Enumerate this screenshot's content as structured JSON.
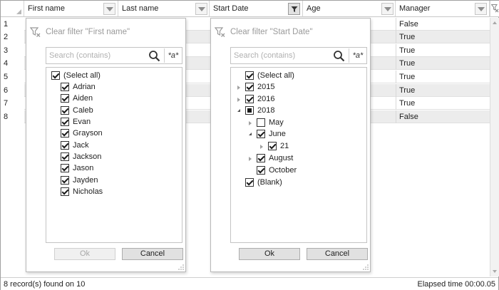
{
  "columns": [
    {
      "label": "First name",
      "filter_active": false
    },
    {
      "label": "Last name",
      "filter_active": false
    },
    {
      "label": "Start Date",
      "filter_active": true
    },
    {
      "label": "Age",
      "filter_active": false
    },
    {
      "label": "Manager",
      "filter_active": false
    }
  ],
  "rows": [
    {
      "num": "1",
      "manager": "False"
    },
    {
      "num": "2",
      "manager": "True"
    },
    {
      "num": "3",
      "manager": "True"
    },
    {
      "num": "4",
      "manager": "True"
    },
    {
      "num": "5",
      "manager": "True"
    },
    {
      "num": "6",
      "manager": "True"
    },
    {
      "num": "7",
      "manager": "True"
    },
    {
      "num": "8",
      "manager": "False"
    }
  ],
  "status": {
    "left": "8 record(s) found on 10",
    "right": "Elapsed time 00:00.05"
  },
  "filter_first_name": {
    "clear_label": "Clear filter \"First name\"",
    "search_placeholder": "Search (contains)",
    "regex_label": "*a*",
    "items": [
      {
        "label": "(Select all)",
        "checked": true
      },
      {
        "label": "Adrian",
        "checked": true
      },
      {
        "label": "Aiden",
        "checked": true
      },
      {
        "label": "Caleb",
        "checked": true
      },
      {
        "label": "Evan",
        "checked": true
      },
      {
        "label": "Grayson",
        "checked": true
      },
      {
        "label": "Jack",
        "checked": true
      },
      {
        "label": "Jackson",
        "checked": true
      },
      {
        "label": "Jason",
        "checked": true
      },
      {
        "label": "Jayden",
        "checked": true
      },
      {
        "label": "Nicholas",
        "checked": true
      }
    ],
    "ok_label": "Ok",
    "ok_enabled": false,
    "cancel_label": "Cancel"
  },
  "filter_start_date": {
    "clear_label": "Clear filter \"Start Date\"",
    "search_placeholder": "Search (contains)",
    "regex_label": "*a*",
    "items": [
      {
        "label": "(Select all)",
        "state": "checked",
        "expander": "none"
      },
      {
        "label": "2015",
        "state": "checked",
        "expander": "collapsed"
      },
      {
        "label": "2016",
        "state": "checked",
        "expander": "collapsed"
      },
      {
        "label": "2018",
        "state": "partial",
        "expander": "expanded"
      },
      {
        "label": "May",
        "state": "unchecked",
        "expander": "collapsed"
      },
      {
        "label": "June",
        "state": "checked",
        "expander": "expanded"
      },
      {
        "label": "21",
        "state": "checked",
        "expander": "none"
      },
      {
        "label": "August",
        "state": "checked",
        "expander": "collapsed"
      },
      {
        "label": "October",
        "state": "checked",
        "expander": "collapsed"
      },
      {
        "label": "(Blank)",
        "state": "checked",
        "expander": "none"
      }
    ],
    "ok_label": "Ok",
    "ok_enabled": true,
    "cancel_label": "Cancel"
  }
}
